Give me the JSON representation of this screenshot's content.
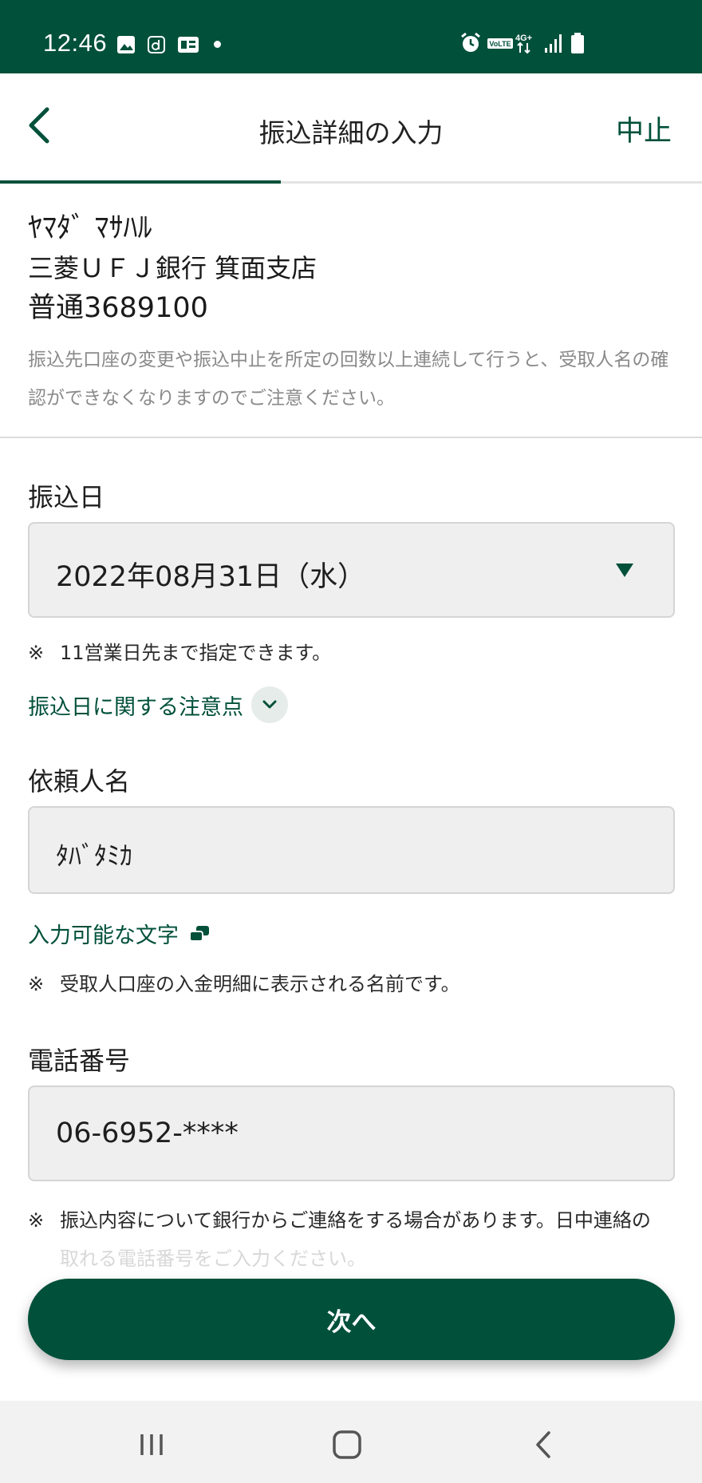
{
  "status_bar": {
    "time": "12:46",
    "left_icons": [
      "image-icon",
      "d-app-icon",
      "card-icon",
      "dot-icon"
    ],
    "right_icons": [
      "alarm-icon",
      "volte-icon",
      "4g-plus-icon",
      "signal-icon",
      "battery-icon"
    ],
    "network_label": "4G+",
    "volte_label": "VoLTE"
  },
  "header": {
    "title": "振込詳細の入力",
    "cancel_label": "中止",
    "back_icon": "chevron-left-icon",
    "progress": 0.4
  },
  "recipient": {
    "name": "ﾔﾏﾀﾞ ﾏｻﾊﾙ",
    "bank": "三菱ＵＦＪ銀行 箕面支店",
    "account": "普通3689100",
    "note": "振込先口座の変更や振込中止を所定の回数以上連続して行うと、受取人名の確認ができなくなりますのでご注意ください。"
  },
  "transfer_date": {
    "label": "振込日",
    "value": "2022年08月31日（水）",
    "note_mark": "※",
    "note": "11営業日先まで指定できます。",
    "notice_link": "振込日に関する注意点"
  },
  "requester": {
    "label": "依頼人名",
    "value": "ﾀﾊﾞﾀﾐｶ",
    "chars_link": "入力可能な文字",
    "note_mark": "※",
    "note": "受取人口座の入金明細に表示される名前です。"
  },
  "phone": {
    "label": "電話番号",
    "value": "06-6952-****",
    "note_mark": "※",
    "note_line1": "振込内容について銀行からご連絡をする場合があります。日中連絡の",
    "note_line2": "取れる電話番号をご入力ください。"
  },
  "next_button_label": "次へ",
  "colors": {
    "brand_green": "#00503a",
    "field_bg": "#efefef",
    "note_gray": "#8a8a8a"
  }
}
